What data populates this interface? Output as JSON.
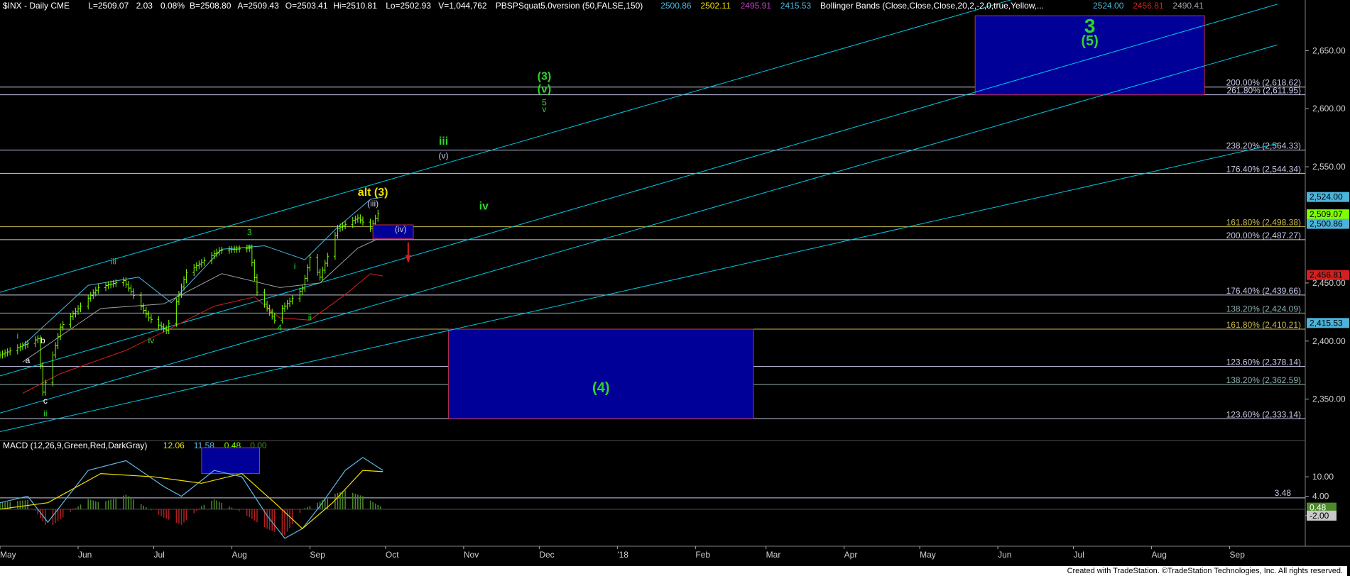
{
  "header": {
    "symbol": "$INX - Daily  CME",
    "L": "L=2509.07",
    "chg": "2.03",
    "pct": "0.08%",
    "B": "B=2508.80",
    "A": "A=2509.43",
    "O": "O=2503.41",
    "Hi": "Hi=2510.81",
    "Lo": "Lo=2502.93",
    "V": "V=1,044,762",
    "ind1": "PBSPSquat5.0version (50,FALSE,150)",
    "ind1_vals": [
      "2500.86",
      "2502.11",
      "2495.91",
      "2415.53"
    ],
    "ind2": "Bollinger Bands (Close,Close,Close,20,2,-2,0,true,Yellow,...",
    "ind2_vals": [
      "2524.00",
      "2456.81",
      "2490.41"
    ]
  },
  "colors": {
    "background": "#000000",
    "bars": "#7fff00",
    "fib_line": "#c8c8e6",
    "channel": "#00c8e6",
    "bb_mid": "#9ea0a8",
    "bb_upper": "#4bb4dc",
    "red": "#d42020",
    "box_fill": "#000098",
    "wave_green": "#2fd42f",
    "yellow": "#f0e000",
    "macd_line": "#5fb8e8",
    "macd_signal": "#f0e000",
    "hist_pos": "#4c8a2a",
    "hist_neg": "#b02020"
  },
  "chart_data": {
    "type": "candlestick",
    "title": "$INX - Daily",
    "y_range": [
      2315,
      2685
    ],
    "y_ticks": [
      "2,650.00",
      "2,600.00",
      "2,550.00",
      "2,450.00",
      "2,400.00",
      "2,350.00"
    ],
    "x_range": [
      "2017-05-01",
      "2018-10-01"
    ],
    "x_ticks": [
      {
        "label": "May",
        "date": "2017-05-01"
      },
      {
        "label": "Jun",
        "date": "2017-06-01"
      },
      {
        "label": "Jul",
        "date": "2017-07-01"
      },
      {
        "label": "Aug",
        "date": "2017-08-01"
      },
      {
        "label": "Sep",
        "date": "2017-09-01"
      },
      {
        "label": "Oct",
        "date": "2017-10-01"
      },
      {
        "label": "Nov",
        "date": "2017-11-01"
      },
      {
        "label": "Dec",
        "date": "2017-12-01"
      },
      {
        "label": "'18",
        "date": "2018-01-01"
      },
      {
        "label": "Feb",
        "date": "2018-02-01"
      },
      {
        "label": "Mar",
        "date": "2018-03-01"
      },
      {
        "label": "Apr",
        "date": "2018-04-01"
      },
      {
        "label": "May",
        "date": "2018-05-01"
      },
      {
        "label": "Jun",
        "date": "2018-06-01"
      },
      {
        "label": "Jul",
        "date": "2018-07-01"
      },
      {
        "label": "Aug",
        "date": "2018-08-01"
      },
      {
        "label": "Sep",
        "date": "2018-09-01"
      }
    ],
    "price_path": [
      [
        "2017-05-01",
        2388
      ],
      [
        "2017-05-10",
        2396
      ],
      [
        "2017-05-16",
        2402
      ],
      [
        "2017-05-18",
        2356
      ],
      [
        "2017-05-25",
        2412
      ],
      [
        "2017-06-09",
        2446
      ],
      [
        "2017-06-19",
        2452
      ],
      [
        "2017-06-29",
        2420
      ],
      [
        "2017-07-06",
        2409
      ],
      [
        "2017-07-14",
        2459
      ],
      [
        "2017-07-27",
        2478
      ],
      [
        "2017-08-08",
        2480
      ],
      [
        "2017-08-11",
        2442
      ],
      [
        "2017-08-18",
        2418
      ],
      [
        "2017-08-21",
        2428
      ],
      [
        "2017-08-29",
        2445
      ],
      [
        "2017-09-01",
        2472
      ],
      [
        "2017-09-05",
        2455
      ],
      [
        "2017-09-12",
        2497
      ],
      [
        "2017-09-20",
        2506
      ],
      [
        "2017-09-25",
        2497
      ],
      [
        "2017-09-28",
        2510
      ]
    ],
    "price_labels": [
      {
        "text": "2,524.00",
        "value": 2524,
        "bg": "#4bb4dc",
        "fg": "#000000"
      },
      {
        "text": "2,509.07",
        "value": 2509.07,
        "bg": "#7fff00",
        "fg": "#000000"
      },
      {
        "text": "2,500.86",
        "value": 2500.86,
        "bg": "#4bb4dc",
        "fg": "#000000"
      },
      {
        "text": "2,456.81",
        "value": 2456.81,
        "bg": "#d42020",
        "fg": "#000000"
      },
      {
        "text": "2,415.53",
        "value": 2415.53,
        "bg": "#4bb4dc",
        "fg": "#000000"
      }
    ],
    "fib_lines": [
      {
        "label": "200.00% (2,618.62)",
        "value": 2618.62,
        "color": "#c8c8e6"
      },
      {
        "label": "261.80% (2,611.95)",
        "value": 2611.95,
        "color": "#c8c8e6"
      },
      {
        "label": "238.20% (2,564.33)",
        "value": 2564.33,
        "color": "#c8c8e6"
      },
      {
        "label": "176.40% (2,544.34)",
        "value": 2544.34,
        "color": "#c8c8e6"
      },
      {
        "label": "161.80% (2,498.38)",
        "value": 2498.38,
        "color": "#c8b850"
      },
      {
        "label": "200.00% (2,487.27)",
        "value": 2487.27,
        "color": "#c8c8e6"
      },
      {
        "label": "176.40% (2,439.66)",
        "value": 2439.66,
        "color": "#c8c8e6"
      },
      {
        "label": "138.20% (2,424.09)",
        "value": 2424.09,
        "color": "#8fb0b0"
      },
      {
        "label": "161.80% (2,410.21)",
        "value": 2410.21,
        "color": "#c8b850"
      },
      {
        "label": "123.60% (2,378.14)",
        "value": 2378.14,
        "color": "#c8c8e6"
      },
      {
        "label": "138.20% (2,362.59)",
        "value": 2362.59,
        "color": "#8fb0b0"
      },
      {
        "label": "123.60% (2,333.14)",
        "value": 2333.14,
        "color": "#c8c8e6"
      }
    ],
    "target_boxes": [
      {
        "x": [
          "2018-05-23",
          "2018-08-22"
        ],
        "y": [
          2611.95,
          2680
        ],
        "labels": [
          "3",
          "(5)"
        ]
      },
      {
        "x": [
          "2017-10-26",
          "2018-02-24"
        ],
        "y": [
          2333.14,
          2410.21
        ],
        "labels": [
          "(4)"
        ]
      }
    ],
    "wave_labels": [
      {
        "text": "i",
        "date": "2017-05-08",
        "value": 2402,
        "color": "#2fd42f"
      },
      {
        "text": "b",
        "date": "2017-05-18",
        "value": 2398,
        "color": "#ffffff"
      },
      {
        "text": "a",
        "date": "2017-05-12",
        "value": 2381,
        "color": "#ffffff"
      },
      {
        "text": "c",
        "date": "2017-05-19",
        "value": 2346,
        "color": "#ffffff"
      },
      {
        "text": "ii",
        "date": "2017-05-19",
        "value": 2335,
        "color": "#2fd42f"
      },
      {
        "text": "iii",
        "date": "2017-06-15",
        "value": 2466,
        "color": "#2fd42f"
      },
      {
        "text": "iv",
        "date": "2017-06-30",
        "value": 2398,
        "color": "#2fd42f"
      },
      {
        "text": "3",
        "date": "2017-08-08",
        "value": 2491,
        "color": "#2fd42f"
      },
      {
        "text": "v",
        "date": "2017-08-08",
        "value": 2479,
        "color": "#2fd42f"
      },
      {
        "text": "i",
        "date": "2017-08-26",
        "value": 2462,
        "color": "#2fd42f"
      },
      {
        "text": "4",
        "date": "2017-08-20",
        "value": 2409,
        "color": "#2fd42f"
      },
      {
        "text": "ii",
        "date": "2017-09-01",
        "value": 2418,
        "color": "#2fd42f"
      },
      {
        "text": "alt (3)",
        "date": "2017-09-26",
        "value": 2525,
        "color": "#f0e000",
        "bold": true
      },
      {
        "text": "(iii)",
        "date": "2017-09-26",
        "value": 2516,
        "color": "#c8c8e6"
      },
      {
        "text": "(iv)",
        "date": "2017-10-07",
        "value": 2494,
        "color": "#c8c8e6"
      },
      {
        "text": "iii",
        "date": "2017-10-24",
        "value": 2569,
        "color": "#2fd42f",
        "bold": true
      },
      {
        "text": "(v)",
        "date": "2017-10-24",
        "value": 2557,
        "color": "#c8c8e6"
      },
      {
        "text": "iv",
        "date": "2017-11-09",
        "value": 2513,
        "color": "#2fd42f",
        "bold": true
      },
      {
        "text": "(3)",
        "date": "2017-12-03",
        "value": 2625,
        "color": "#2fd42f",
        "bold": true
      },
      {
        "text": "(v)",
        "date": "2017-12-03",
        "value": 2614,
        "color": "#2fd42f",
        "bold": true
      },
      {
        "text": "5",
        "date": "2017-12-03",
        "value": 2603,
        "color": "#2fd42f"
      },
      {
        "text": "v",
        "date": "2017-12-03",
        "value": 2597,
        "color": "#2fd42f"
      }
    ],
    "macd": {
      "legend": "MACD (12,26,9,Green,Red,DarkGray)",
      "values": [
        "12.06",
        "11.58",
        "0.48",
        "0.00"
      ],
      "value_colors": [
        "#f0e000",
        "#5fb8e8",
        "#7fff00",
        "#4c8a2a"
      ],
      "y_ticks": [
        "10.00",
        "4.00",
        "-2.00"
      ],
      "level_label": "3.48",
      "y_range": [
        -11,
        21
      ],
      "price_labels": [
        {
          "text": "0.48",
          "value": 0.48,
          "bg": "#4c8a2a",
          "fg": "#ffffff"
        },
        {
          "text": "-2.00",
          "value": -2.0,
          "bg": "#c8c8c8",
          "fg": "#000000"
        }
      ],
      "line_path": [
        [
          "2017-05-01",
          2
        ],
        [
          "2017-05-12",
          4
        ],
        [
          "2017-05-20",
          -4
        ],
        [
          "2017-06-05",
          12
        ],
        [
          "2017-06-20",
          15
        ],
        [
          "2017-07-05",
          7
        ],
        [
          "2017-07-12",
          4
        ],
        [
          "2017-07-25",
          12
        ],
        [
          "2017-08-05",
          10
        ],
        [
          "2017-08-15",
          -2
        ],
        [
          "2017-08-22",
          -9
        ],
        [
          "2017-08-29",
          -6
        ],
        [
          "2017-09-05",
          1
        ],
        [
          "2017-09-15",
          12
        ],
        [
          "2017-09-22",
          16
        ],
        [
          "2017-09-30",
          12
        ]
      ],
      "signal_path": [
        [
          "2017-05-01",
          0
        ],
        [
          "2017-05-20",
          2
        ],
        [
          "2017-06-10",
          11
        ],
        [
          "2017-07-01",
          10
        ],
        [
          "2017-07-20",
          8
        ],
        [
          "2017-08-05",
          11
        ],
        [
          "2017-08-18",
          2
        ],
        [
          "2017-08-29",
          -6
        ],
        [
          "2017-09-10",
          2
        ],
        [
          "2017-09-22",
          12
        ],
        [
          "2017-09-30",
          11.6
        ]
      ]
    }
  },
  "footer": {
    "credit": "Created with TradeStation. ©TradeStation Technologies, Inc. All rights reserved."
  }
}
